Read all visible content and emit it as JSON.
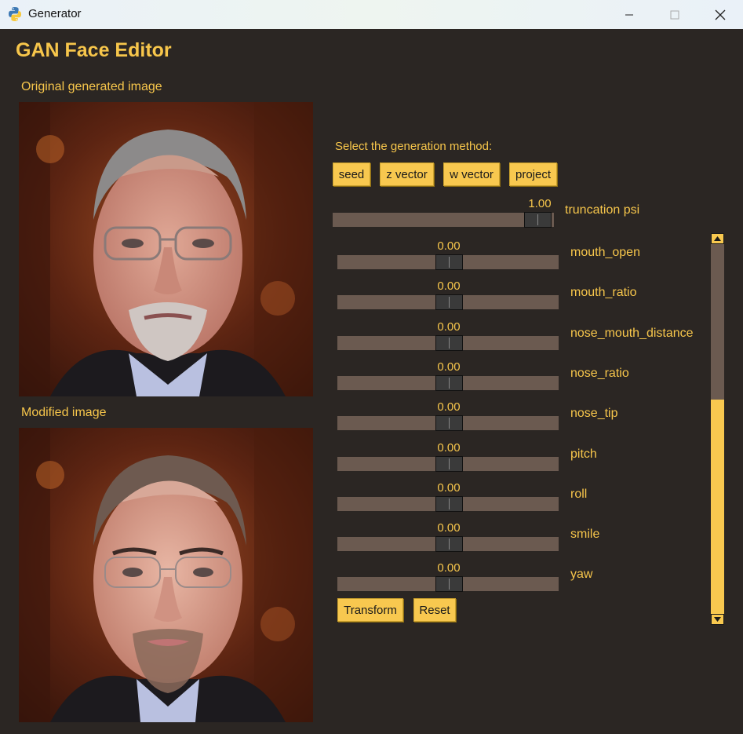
{
  "window": {
    "title": "Generator",
    "minimize_icon": "minimize-icon",
    "maximize_icon": "maximize-icon",
    "close_icon": "close-icon"
  },
  "app": {
    "title": "GAN Face Editor"
  },
  "images": {
    "original_label": "Original generated image",
    "modified_label": "Modified image"
  },
  "generation": {
    "label": "Select the generation method:",
    "buttons": [
      "seed",
      "z vector",
      "w vector",
      "project"
    ]
  },
  "truncation": {
    "label": "truncation psi",
    "value": "1.00",
    "level": 1.0
  },
  "sliders": [
    {
      "name": "mouth_open",
      "value": "0.00",
      "level": 0.5
    },
    {
      "name": "mouth_ratio",
      "value": "0.00",
      "level": 0.5
    },
    {
      "name": "nose_mouth_distance",
      "value": "0.00",
      "level": 0.5
    },
    {
      "name": "nose_ratio",
      "value": "0.00",
      "level": 0.5
    },
    {
      "name": "nose_tip",
      "value": "0.00",
      "level": 0.5
    },
    {
      "name": "pitch",
      "value": "0.00",
      "level": 0.5
    },
    {
      "name": "roll",
      "value": "0.00",
      "level": 0.5
    },
    {
      "name": "smile",
      "value": "0.00",
      "level": 0.5
    },
    {
      "name": "yaw",
      "value": "0.00",
      "level": 0.5
    }
  ],
  "actions": {
    "transform_label": "Transform",
    "reset_label": "Reset"
  },
  "scrollbar": {
    "position_fraction": 0.42,
    "visible_fraction": 0.58
  },
  "colors": {
    "accent": "#f7c64b",
    "background": "#2b2623",
    "track": "#6b5a50"
  }
}
